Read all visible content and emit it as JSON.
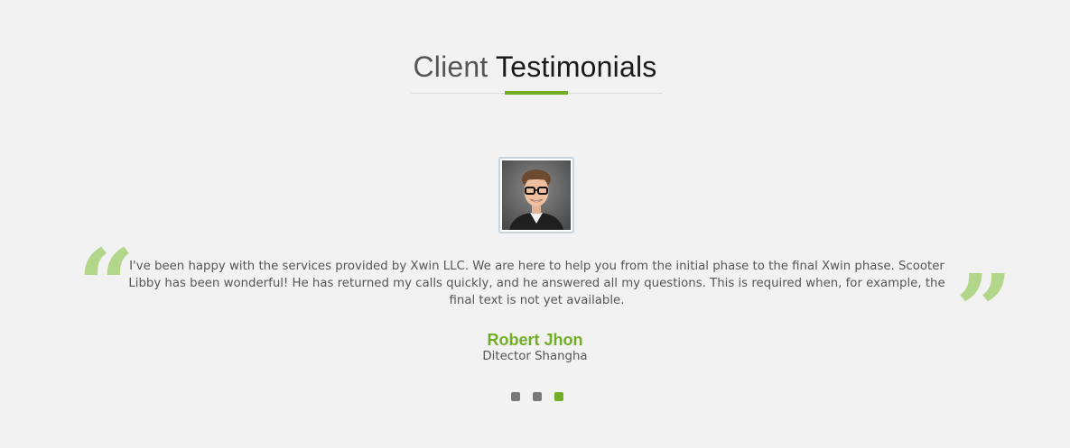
{
  "heading": {
    "light": "Client",
    "bold": "Testimonials"
  },
  "colors": {
    "accent": "#72ad28",
    "quote_mark": "#b2d68a",
    "background": "#f2f2f2",
    "dot_inactive": "#7a7a7a"
  },
  "testimonial": {
    "avatar_icon": "person-photo",
    "open_quote": "“",
    "close_quote": "”",
    "text": "I've been happy with the services provided by Xwin LLC. We are here to help you from the initial phase to the final Xwin phase. Scooter Libby has been wonderful! He has returned my calls quickly, and he answered all my questions. This is required when, for example, the final text is not yet available.",
    "author": "Robert Jhon",
    "role": "Ditector Shangha"
  },
  "pagination": {
    "total": 3,
    "active_index": 2
  }
}
